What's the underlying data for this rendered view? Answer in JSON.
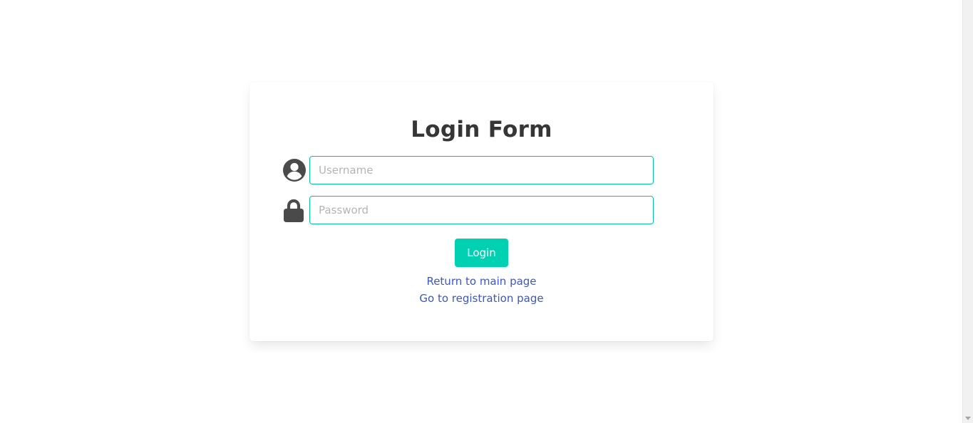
{
  "form": {
    "title": "Login Form",
    "username_placeholder": "Username",
    "password_placeholder": "Password",
    "submit_label": "Login"
  },
  "links": {
    "main_page": "Return to main page",
    "registration_page": "Go to registration page"
  },
  "icons": {
    "username": "user-circle-icon",
    "password": "lock-icon"
  },
  "colors": {
    "accent": "#00d1b2",
    "input_border": "#00c4a7",
    "link": "#3e56c4",
    "title": "#363636",
    "icon": "#4a4a4a"
  }
}
